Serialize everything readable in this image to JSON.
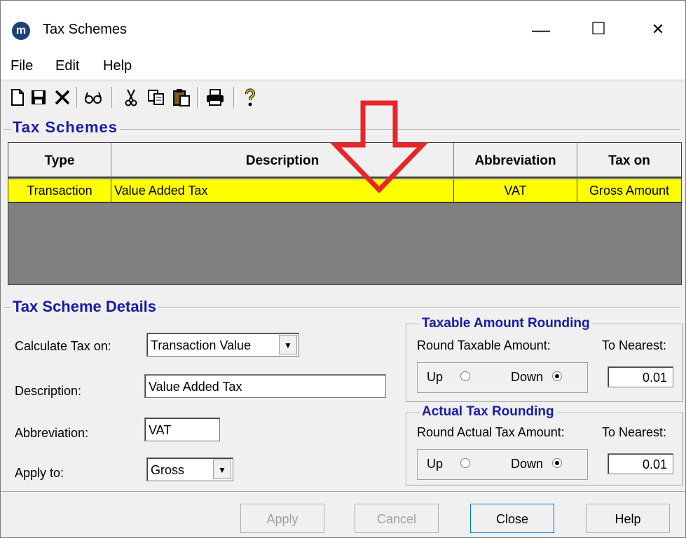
{
  "window": {
    "title": "Tax Schemes",
    "app_icon_text": "m",
    "minimize": "—",
    "maximize": "☐",
    "close": "✕"
  },
  "menu": {
    "items": [
      "File",
      "Edit",
      "Help"
    ]
  },
  "toolbar": {
    "icons": [
      "new-document-icon",
      "save-icon",
      "delete-icon",
      "view-glasses-icon",
      "cut-icon",
      "copy-icon",
      "paste-icon",
      "print-icon",
      "help-icon"
    ]
  },
  "schemes": {
    "title": "Tax Schemes",
    "columns": [
      "Type",
      "Description",
      "Abbreviation",
      "Tax on"
    ],
    "rows": [
      [
        "Transaction",
        "Value Added Tax",
        "VAT",
        "Gross Amount"
      ]
    ],
    "selected_row_color": "#ffff00"
  },
  "details": {
    "title": "Tax Scheme Details",
    "calc_label": "Calculate Tax on:",
    "calc_value": "Transaction Value",
    "desc_label": "Description:",
    "desc_value": "Value Added Tax",
    "abbr_label": "Abbreviation:",
    "abbr_value": "VAT",
    "apply_label": "Apply to:",
    "apply_value": "Gross"
  },
  "taxable_rounding": {
    "title": "Taxable Amount Rounding",
    "round_label": "Round Taxable Amount:",
    "nearest_label": "To Nearest:",
    "up_label": "Up",
    "down_label": "Down",
    "selected": "Down",
    "nearest_value": "0.01"
  },
  "actual_rounding": {
    "title": "Actual Tax Rounding",
    "round_label": "Round Actual Tax Amount:",
    "nearest_label": "To Nearest:",
    "up_label": "Up",
    "down_label": "Down",
    "selected": "Down",
    "nearest_value": "0.01"
  },
  "buttons": {
    "apply": "Apply",
    "cancel": "Cancel",
    "close": "Close",
    "help": "Help"
  },
  "colors": {
    "group_title": "#1a1aa6",
    "annotation_arrow": "#e8262a",
    "selected_row": "#ffff00"
  }
}
